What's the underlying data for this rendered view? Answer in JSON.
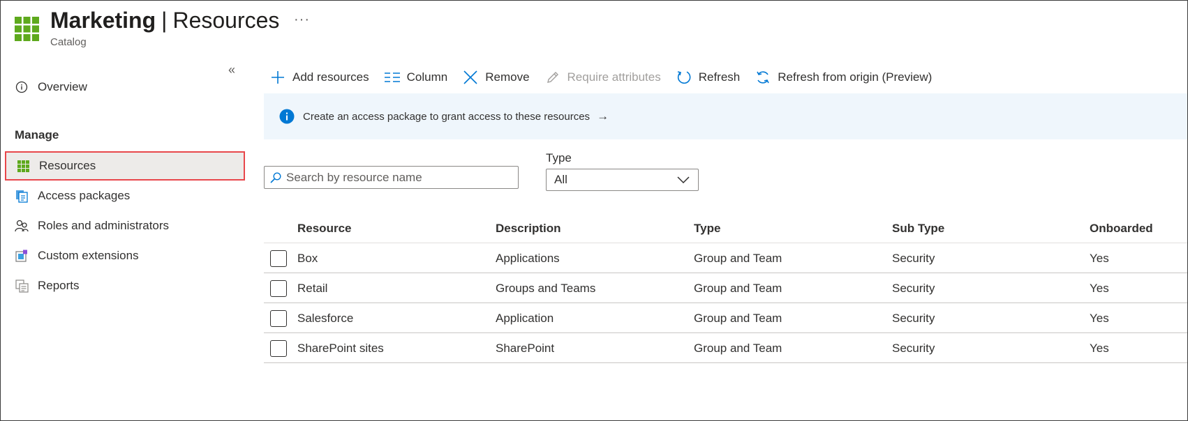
{
  "header": {
    "title": "Marketing",
    "separator": "|",
    "section": "Resources",
    "more": "···",
    "subtitle": "Catalog"
  },
  "sidebar": {
    "collapse": "«",
    "manage_label": "Manage",
    "items": [
      {
        "label": "Overview",
        "icon": "info-icon"
      },
      {
        "label": "Resources",
        "icon": "grid-icon",
        "selected": true
      },
      {
        "label": "Access packages",
        "icon": "package-icon"
      },
      {
        "label": "Roles and administrators",
        "icon": "people-icon"
      },
      {
        "label": "Custom extensions",
        "icon": "extension-icon"
      },
      {
        "label": "Reports",
        "icon": "report-icon"
      }
    ]
  },
  "toolbar": {
    "add": "Add resources",
    "column": "Column",
    "remove": "Remove",
    "require": "Require attributes",
    "refresh": "Refresh",
    "refresh_origin": "Refresh from origin (Preview)"
  },
  "banner": {
    "text": "Create an access package to grant access to these resources",
    "arrow": "→"
  },
  "filters": {
    "search_placeholder": "Search by resource name",
    "type_label": "Type",
    "type_value": "All"
  },
  "table": {
    "columns": [
      "Resource",
      "Description",
      "Type",
      "Sub Type",
      "Onboarded"
    ],
    "rows": [
      {
        "resource": "Box",
        "description": "Applications",
        "type": "Group and Team",
        "subtype": "Security",
        "onboarded": "Yes"
      },
      {
        "resource": "Retail",
        "description": "Groups and Teams",
        "type": "Group and Team",
        "subtype": "Security",
        "onboarded": "Yes"
      },
      {
        "resource": "Salesforce",
        "description": "Application",
        "type": "Group and Team",
        "subtype": "Security",
        "onboarded": "Yes"
      },
      {
        "resource": "SharePoint sites",
        "description": "SharePoint",
        "type": "Group and Team",
        "subtype": "Security",
        "onboarded": "Yes"
      }
    ]
  },
  "colors": {
    "accent": "#0078d4",
    "brand_green": "#5ea91d",
    "selection_border": "#e8474b",
    "banner_bg": "#eff6fc"
  }
}
